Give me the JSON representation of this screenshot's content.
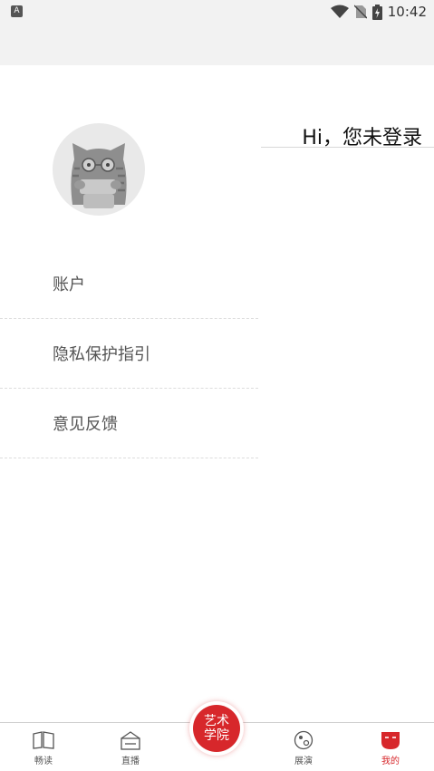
{
  "status_bar": {
    "left_icon": "A",
    "time": "10:42",
    "icons": [
      "wifi-icon",
      "no-sim-icon",
      "battery-charging-icon"
    ]
  },
  "profile": {
    "avatar_icon": "cat-avatar-icon",
    "greeting": "Hi，您未登录"
  },
  "menu": {
    "items": [
      {
        "label": "账户"
      },
      {
        "label": "隐私保护指引"
      },
      {
        "label": "意见反馈"
      }
    ]
  },
  "tabbar": {
    "tabs": [
      {
        "label": "畅读",
        "icon": "book-icon"
      },
      {
        "label": "直播",
        "icon": "tv-icon"
      },
      {
        "label": "展演",
        "icon": "globe-icon"
      },
      {
        "label": "我的",
        "icon": "face-icon"
      }
    ],
    "center": {
      "line1": "艺术",
      "line2": "学院"
    },
    "active_color": "#d7272b"
  }
}
